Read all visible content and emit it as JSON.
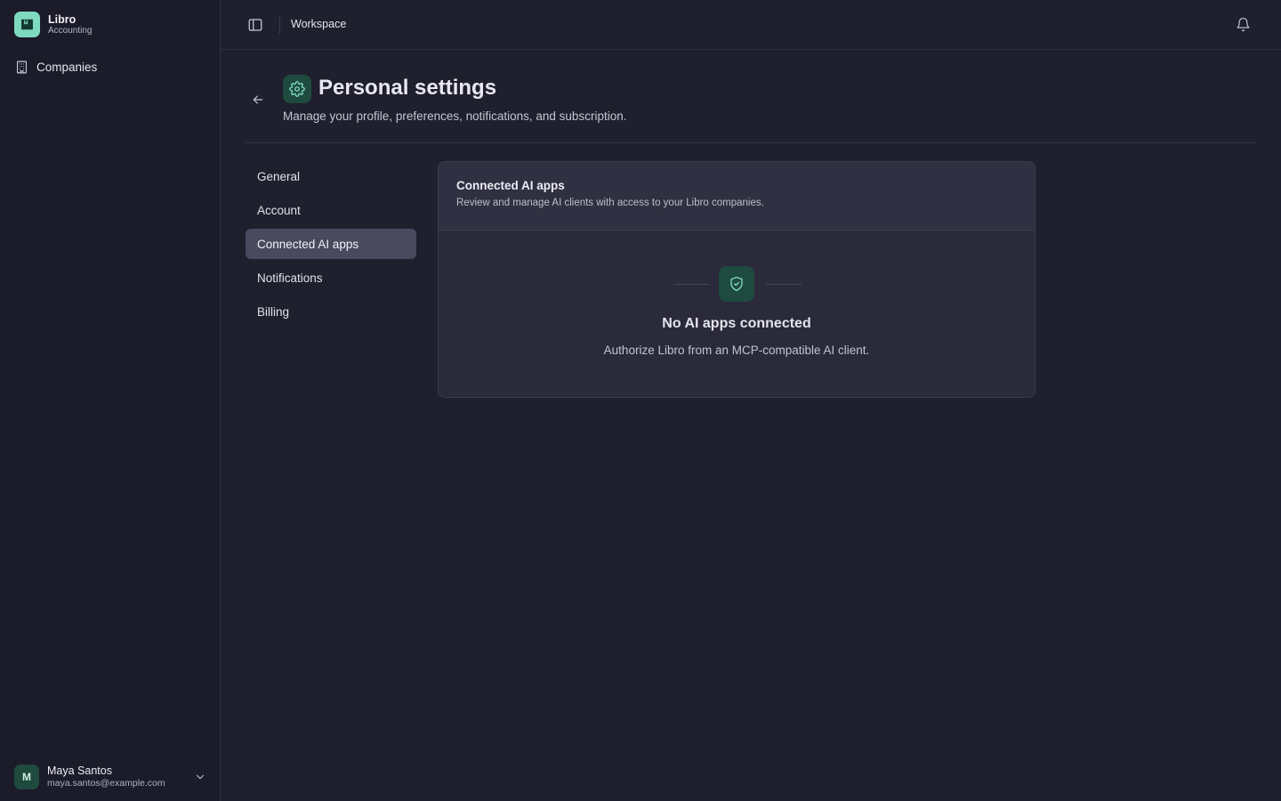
{
  "brand": {
    "name": "Libro",
    "subtitle": "Accounting"
  },
  "sidebar": {
    "items": [
      {
        "label": "Companies",
        "icon": "building-icon"
      }
    ]
  },
  "user": {
    "initial": "M",
    "name": "Maya Santos",
    "email": "maya.santos@example.com"
  },
  "topbar": {
    "breadcrumb": "Workspace"
  },
  "page": {
    "title": "Personal settings",
    "subtitle": "Manage your profile, preferences, notifications, and subscription."
  },
  "settings_nav": {
    "items": [
      {
        "label": "General"
      },
      {
        "label": "Account"
      },
      {
        "label": "Connected AI apps",
        "active": true
      },
      {
        "label": "Notifications"
      },
      {
        "label": "Billing"
      }
    ]
  },
  "card": {
    "title": "Connected AI apps",
    "description": "Review and manage AI clients with access to your Libro companies.",
    "empty_title": "No AI apps connected",
    "empty_text": "Authorize Libro from an MCP-compatible AI client."
  },
  "colors": {
    "accent": "#7fd9c0",
    "accent_dark": "#1f4a3e",
    "background": "#1f1f2e",
    "sidebar": "#1b1b29",
    "active_item": "#4a4a5e"
  }
}
